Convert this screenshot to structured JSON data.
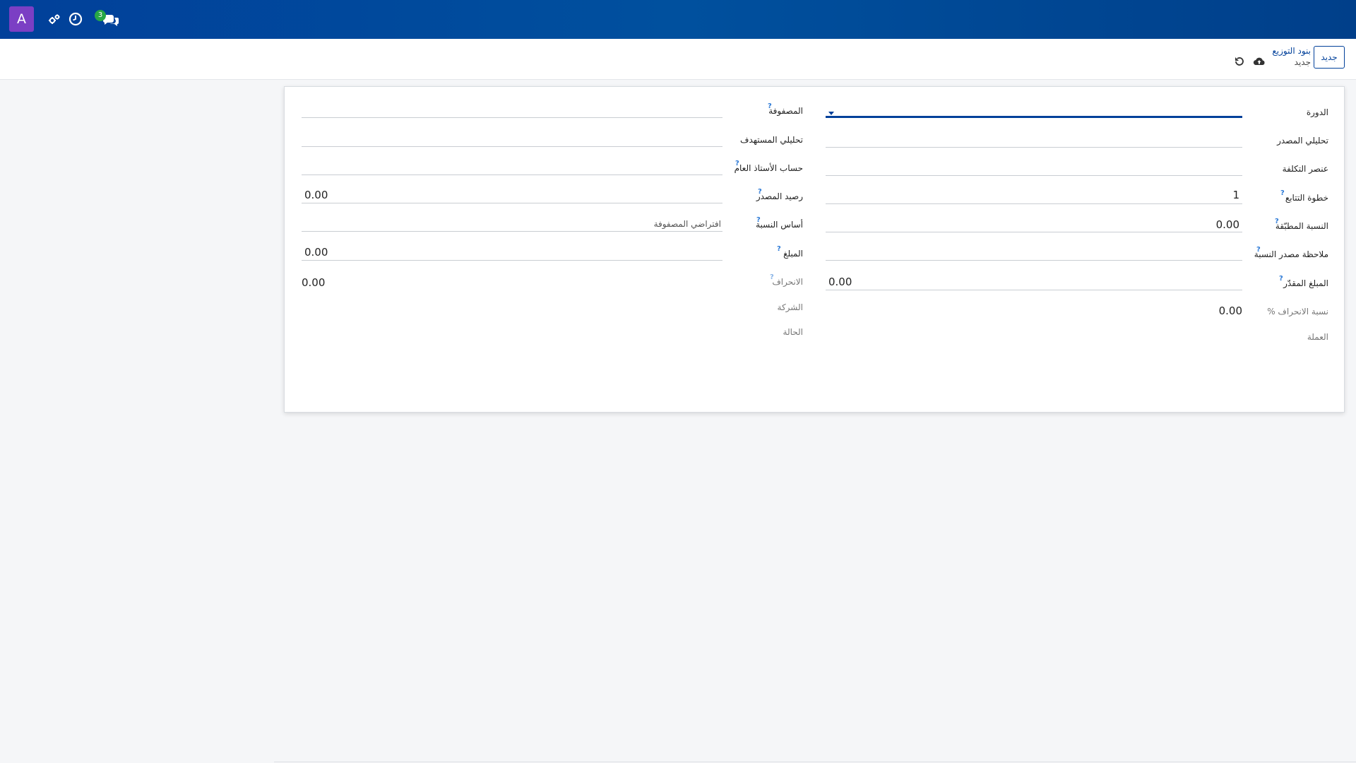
{
  "topbar": {
    "avatar_letter": "A",
    "messages_badge": "3",
    "icons": [
      "settings-gears-icon",
      "clock-icon",
      "chat-icon"
    ]
  },
  "controlbar": {
    "new_button": "جديد",
    "breadcrumb_parent": "بنود التوزيع",
    "breadcrumb_current": "جديد",
    "icons": [
      "cloud-save-icon",
      "undo-icon"
    ]
  },
  "form": {
    "right": {
      "period_label": "الدورة",
      "source_analytic_label": "تحليلي المصدر",
      "cost_element_label": "عنصر التكلفة",
      "sequence_step_label": "خطوة التتابع",
      "sequence_step_value": "1",
      "applied_ratio_label": "النسبة المطبّقة",
      "applied_ratio_value": "0.00",
      "ratio_source_note_label": "ملاحظة مصدر النسبة",
      "estimated_amount_label": "المبلغ المقدّر",
      "estimated_amount_value": "0.00",
      "deviation_pct_label": "نسبة الانحراف %",
      "deviation_pct_value": "0.00",
      "currency_label": "العملة"
    },
    "left": {
      "matrix_label": "المصفوفة",
      "target_analytic_label": "تحليلي المستهدف",
      "gl_account_label": "حساب الأستاذ العام",
      "source_balance_label": "رصيد المصدر",
      "source_balance_value": "0.00",
      "ratio_basis_label": "أساس النسبة",
      "ratio_basis_value": "افتراضي المصفوفة",
      "amount_label": "المبلغ",
      "amount_value": "0.00",
      "deviation_label": "الانحراف",
      "deviation_value": "0.00",
      "company_label": "الشركة",
      "status_label": "الحالة"
    },
    "help_mark": "?"
  },
  "colors": {
    "primary": "#01409a",
    "avatar": "#7b3fc4",
    "badge": "#28a745",
    "help": "#2d7ad6"
  }
}
